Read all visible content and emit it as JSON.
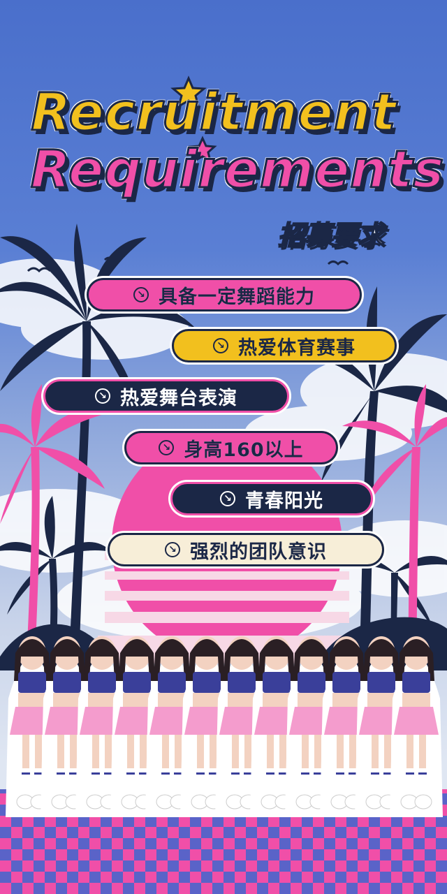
{
  "title_line1": "Recruitment",
  "title_line2": "Requirements",
  "subtitle": "招募要求",
  "requirements": [
    {
      "label": "具备一定舞蹈能力",
      "style": "pink"
    },
    {
      "label": "热爱体育赛事",
      "style": "yellow"
    },
    {
      "label": "热爱舞台表演",
      "style": "navy"
    },
    {
      "label": "身高160以上",
      "style": "pink"
    },
    {
      "label": "青春阳光",
      "style": "navy"
    },
    {
      "label": "强烈的团队意识",
      "style": "cream"
    }
  ],
  "arrow_icon": "arrow-down-right-icon",
  "colors": {
    "sky": "#4a6fcb",
    "pink": "#f04fa8",
    "yellow": "#f2c01e",
    "navy": "#1b2746",
    "cream": "#f7eed8"
  }
}
